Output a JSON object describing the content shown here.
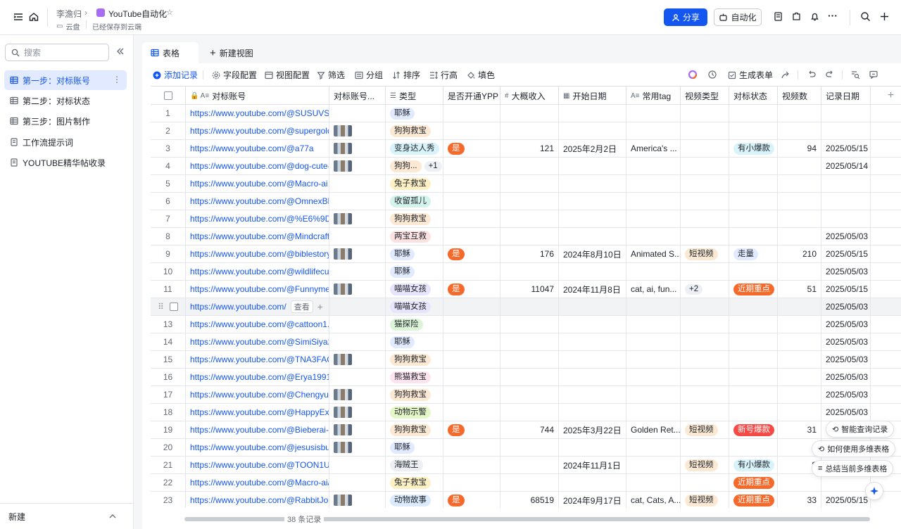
{
  "breadcrumb": {
    "owner": "李澹归",
    "app_name": "YouTube自动化",
    "location": "云盘",
    "save_status": "已经保存到云端"
  },
  "header": {
    "share_label": "分享",
    "automation_label": "自动化"
  },
  "sidebar": {
    "search_placeholder": "搜索",
    "items": [
      {
        "label": "第一步：对标账号",
        "active": true
      },
      {
        "label": "第二步：对标状态"
      },
      {
        "label": "第三步：图片制作"
      },
      {
        "label": "工作流提示词"
      },
      {
        "label": "YOUTUBE精华帖收录"
      }
    ],
    "new_label": "新建"
  },
  "view_tabs": {
    "table_label": "表格",
    "new_view_label": "新建视图"
  },
  "toolbar": {
    "add_record": "添加记录",
    "field_config": "字段配置",
    "view_config": "视图配置",
    "filter": "筛选",
    "group": "分组",
    "sort": "排序",
    "row_height": "行高",
    "fill": "填色",
    "generate_form": "生成表单"
  },
  "columns": [
    "对标账号",
    "对标账号...",
    "类型",
    "是否开通YPP",
    "大概收入",
    "开始日期",
    "常用tag",
    "视频类型",
    "对标状态",
    "视频数",
    "记录日期"
  ],
  "rows": [
    {
      "n": "1",
      "url": "https://www.youtube.com/@SUSUVSJ...",
      "thumb": false,
      "type": "耶稣",
      "ypp": "",
      "income": "",
      "start": "",
      "tag": "",
      "vtype": "",
      "status": "",
      "videos": "",
      "date": ""
    },
    {
      "n": "2",
      "url": "https://www.youtube.com/@supergoldie",
      "thumb": true,
      "type": "狗狗救宝",
      "ypp": "",
      "income": "",
      "start": "",
      "tag": "",
      "vtype": "",
      "status": "",
      "videos": "",
      "date": ""
    },
    {
      "n": "3",
      "url": "https://www.youtube.com/@a77a",
      "thumb": true,
      "type": "变身达人秀",
      "ypp": "是",
      "income": "121",
      "start": "2025年2月2日",
      "tag": "America's ...",
      "vtype": "",
      "status": "有小爆款",
      "videos": "94",
      "date": "2025/05/15"
    },
    {
      "n": "4",
      "url": "https://www.youtube.com/@dog-cute-...",
      "thumb": true,
      "type": "狗狗...",
      "type_extra": "+1",
      "ypp": "",
      "income": "",
      "start": "",
      "tag": "",
      "vtype": "",
      "status": "",
      "videos": "",
      "date": "2025/05/14"
    },
    {
      "n": "5",
      "url": "https://www.youtube.com/@Macro-ai",
      "thumb": false,
      "type": "兔子救宝",
      "ypp": "",
      "income": "",
      "start": "",
      "tag": "",
      "vtype": "",
      "status": "",
      "videos": "",
      "date": ""
    },
    {
      "n": "6",
      "url": "https://www.youtube.com/@OmnexBl...",
      "thumb": false,
      "type": "收留孤儿",
      "ypp": "",
      "income": "",
      "start": "",
      "tag": "",
      "vtype": "",
      "status": "",
      "videos": "",
      "date": ""
    },
    {
      "n": "7",
      "url": "https://www.youtube.com/@%E6%9D...",
      "thumb": true,
      "type": "狗狗救宝",
      "ypp": "",
      "income": "",
      "start": "",
      "tag": "",
      "vtype": "",
      "status": "",
      "videos": "",
      "date": ""
    },
    {
      "n": "8",
      "url": "https://www.youtube.com/@Mindcraft...",
      "thumb": false,
      "type": "两宝互救",
      "ypp": "",
      "income": "",
      "start": "",
      "tag": "",
      "vtype": "",
      "status": "",
      "videos": "",
      "date": "2025/05/03"
    },
    {
      "n": "9",
      "url": "https://www.youtube.com/@biblestory...",
      "thumb": true,
      "type": "耶稣",
      "ypp": "是",
      "income": "176",
      "start": "2024年8月10日",
      "tag": "Animated S...",
      "vtype": "短视频",
      "status": "走量",
      "videos": "210",
      "date": "2025/05/15"
    },
    {
      "n": "10",
      "url": "https://www.youtube.com/@wildlifecu...",
      "thumb": false,
      "type": "耶稣",
      "ypp": "",
      "income": "",
      "start": "",
      "tag": "",
      "vtype": "",
      "status": "",
      "videos": "",
      "date": "2025/05/03"
    },
    {
      "n": "11",
      "url": "https://www.youtube.com/@Funnyme...",
      "thumb": true,
      "type": "喵喵女孩",
      "ypp": "是",
      "income": "11047",
      "start": "2024年11月8日",
      "tag": "cat, ai, fun...",
      "vtype": "+2",
      "status": "近期重点",
      "videos": "51",
      "date": "2025/05/15"
    },
    {
      "n": "",
      "url": "https://www.youtube.com/",
      "thumb": false,
      "type": "喵喵女孩",
      "ypp": "",
      "income": "",
      "start": "",
      "tag": "",
      "vtype": "",
      "status": "",
      "videos": "",
      "date": "2025/05/03",
      "hover": true,
      "view_label": "查看"
    },
    {
      "n": "13",
      "url": "https://www.youtube.com/@cattoon1...",
      "thumb": false,
      "type": "猫探险",
      "ypp": "",
      "income": "",
      "start": "",
      "tag": "",
      "vtype": "",
      "status": "",
      "videos": "",
      "date": "2025/05/03"
    },
    {
      "n": "14",
      "url": "https://www.youtube.com/@SimiSiya23",
      "thumb": false,
      "type": "耶稣",
      "ypp": "",
      "income": "",
      "start": "",
      "tag": "",
      "vtype": "",
      "status": "",
      "videos": "",
      "date": "2025/05/03"
    },
    {
      "n": "15",
      "url": "https://www.youtube.com/@TNA3FAC...",
      "thumb": true,
      "type": "狗狗救宝",
      "ypp": "",
      "income": "",
      "start": "",
      "tag": "",
      "vtype": "",
      "status": "",
      "videos": "",
      "date": "2025/05/03"
    },
    {
      "n": "16",
      "url": "https://www.youtube.com/@Erya1991",
      "thumb": false,
      "type": "熊猫救宝",
      "ypp": "",
      "income": "",
      "start": "",
      "tag": "",
      "vtype": "",
      "status": "",
      "videos": "",
      "date": "2025/05/03"
    },
    {
      "n": "17",
      "url": "https://www.youtube.com/@Chengyu...",
      "thumb": true,
      "type": "狗狗救宝",
      "ypp": "",
      "income": "",
      "start": "",
      "tag": "",
      "vtype": "",
      "status": "",
      "videos": "",
      "date": "2025/05/03"
    },
    {
      "n": "18",
      "url": "https://www.youtube.com/@HappyEx...",
      "thumb": true,
      "type": "动物示警",
      "ypp": "",
      "income": "",
      "start": "",
      "tag": "",
      "vtype": "",
      "status": "",
      "videos": "",
      "date": "2025/05/03"
    },
    {
      "n": "19",
      "url": "https://www.youtube.com/@Bieberai-...",
      "thumb": true,
      "type": "狗狗救宝",
      "ypp": "是",
      "income": "744",
      "start": "2025年3月22日",
      "tag": "Golden Ret...",
      "vtype": "短视频",
      "status": "新号爆款",
      "videos": "31",
      "date": ""
    },
    {
      "n": "20",
      "url": "https://www.youtube.com/@jesusisbu...",
      "thumb": true,
      "type": "耶稣",
      "ypp": "",
      "income": "",
      "start": "",
      "tag": "",
      "vtype": "",
      "status": "",
      "videos": "3",
      "date": ""
    },
    {
      "n": "21",
      "url": "https://www.youtube.com/@TOON1U...",
      "thumb": false,
      "type": "海贼王",
      "ypp": "",
      "income": "",
      "start": "2024年11月1日",
      "tag": "",
      "vtype": "短视频",
      "status": "有小爆款",
      "videos": "8",
      "date": ""
    },
    {
      "n": "22",
      "url": "https://www.youtube.com/@Macro-ai/...",
      "thumb": false,
      "type": "兔子救宝",
      "ypp": "",
      "income": "",
      "start": "",
      "tag": "",
      "vtype": "",
      "status": "近期重点",
      "videos": "",
      "date": ""
    },
    {
      "n": "23",
      "url": "https://www.youtube.com/@RabbitJou...",
      "thumb": true,
      "type": "动物故事",
      "ypp": "是",
      "income": "68519",
      "start": "2024年9月17日",
      "tag": "cat, Cats, A...",
      "vtype": "短视频",
      "status": "近期重点",
      "videos": "33",
      "date": "2025/05/15"
    }
  ],
  "record_count": "38 条记录",
  "floating": {
    "smart_query": "智能查询记录",
    "how_to": "如何使用多维表格",
    "summary": "总结当前多维表格"
  },
  "colors": {
    "accent": "#1456f0",
    "tags": {
      "耶稣": "#e1eaff",
      "狗狗救宝": "#fbe9d4",
      "变身达人秀": "#d9f3fb",
      "狗狗...": "#fbe9d4",
      "兔子救宝": "#fdf0c4",
      "收留孤儿": "#d4f3ec",
      "两宝互救": "#fde2e2",
      "喵喵女孩": "#e8e4fb",
      "猫探险": "#dcf5d9",
      "熊猫救宝": "#fde4ef",
      "动物示警": "#e4f7c7",
      "海贼王": "#eceff3",
      "动物故事": "#dbeafc"
    },
    "status": {
      "有小爆款": "#d9f3fb",
      "走量": "#e1eaff",
      "近期重点": "#f5692b",
      "新号爆款": "#f54a45"
    },
    "ypp": "#f5692b",
    "vtype": "#fbe9d4"
  }
}
